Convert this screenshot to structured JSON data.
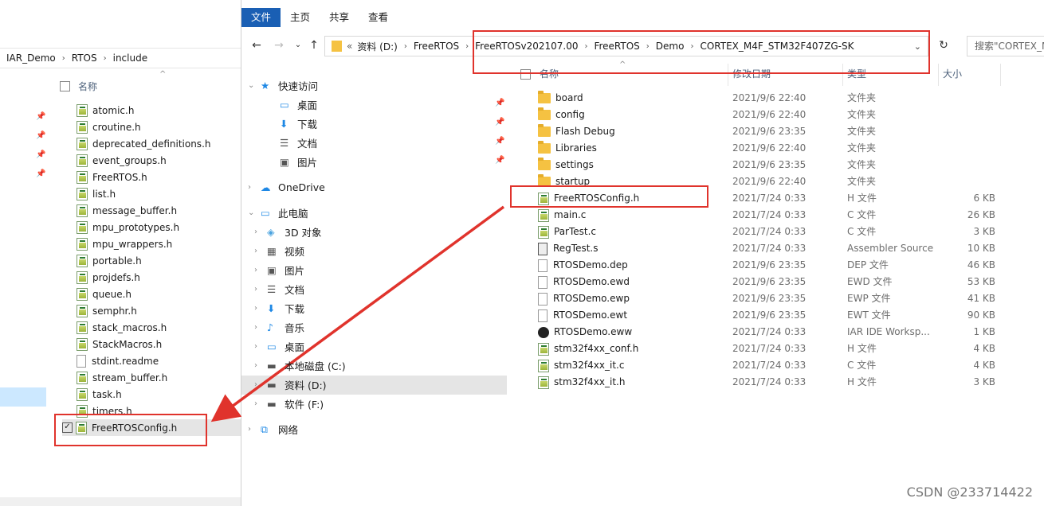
{
  "left_window": {
    "breadcrumb": [
      "IAR_Demo",
      "RTOS",
      "include"
    ],
    "column_name": "名称",
    "files": [
      "atomic.h",
      "croutine.h",
      "deprecated_definitions.h",
      "event_groups.h",
      "FreeRTOS.h",
      "list.h",
      "message_buffer.h",
      "mpu_prototypes.h",
      "mpu_wrappers.h",
      "portable.h",
      "projdefs.h",
      "queue.h",
      "semphr.h",
      "stack_macros.h",
      "StackMacros.h",
      "stdint.readme",
      "stream_buffer.h",
      "task.h",
      "timers.h"
    ],
    "selected_file": "FreeRTOSConfig.h"
  },
  "right_window": {
    "menu": [
      "文件",
      "主页",
      "共享",
      "查看"
    ],
    "address_prefix": "«",
    "address": [
      "资料 (D:)",
      "FreeRTOS",
      "FreeRTOSv202107.00",
      "FreeRTOS",
      "Demo",
      "CORTEX_M4F_STM32F407ZG-SK"
    ],
    "search_placeholder": "搜索\"CORTEX_M",
    "columns": {
      "name": "名称",
      "date": "修改日期",
      "type": "类型",
      "size": "大小"
    },
    "nav": [
      {
        "label": "快速访问",
        "icon": "star-icon"
      },
      {
        "label": "桌面",
        "icon": "desktop-icon",
        "pinned": true
      },
      {
        "label": "下载",
        "icon": "download-icon",
        "pinned": true
      },
      {
        "label": "文档",
        "icon": "document-icon",
        "pinned": true
      },
      {
        "label": "图片",
        "icon": "picture-icon",
        "pinned": true
      },
      {
        "label": "OneDrive",
        "icon": "cloud-icon"
      },
      {
        "label": "此电脑",
        "icon": "computer-icon"
      },
      {
        "label": "3D 对象",
        "icon": "cube-icon"
      },
      {
        "label": "视频",
        "icon": "video-icon"
      },
      {
        "label": "图片",
        "icon": "picture-icon"
      },
      {
        "label": "文档",
        "icon": "document-icon"
      },
      {
        "label": "下载",
        "icon": "download-icon"
      },
      {
        "label": "音乐",
        "icon": "music-icon"
      },
      {
        "label": "桌面",
        "icon": "desktop-icon"
      },
      {
        "label": "本地磁盘 (C:)",
        "icon": "drive-icon"
      },
      {
        "label": "资料 (D:)",
        "icon": "drive-icon"
      },
      {
        "label": "软件 (F:)",
        "icon": "drive-icon"
      },
      {
        "label": "网络",
        "icon": "network-icon"
      }
    ],
    "files": [
      {
        "name": "board",
        "date": "2021/9/6 22:40",
        "type": "文件夹",
        "size": "",
        "icon": "folder-icon"
      },
      {
        "name": "config",
        "date": "2021/9/6 22:40",
        "type": "文件夹",
        "size": "",
        "icon": "folder-icon"
      },
      {
        "name": "Flash Debug",
        "date": "2021/9/6 23:35",
        "type": "文件夹",
        "size": "",
        "icon": "folder-icon"
      },
      {
        "name": "Libraries",
        "date": "2021/9/6 22:40",
        "type": "文件夹",
        "size": "",
        "icon": "folder-icon"
      },
      {
        "name": "settings",
        "date": "2021/9/6 23:35",
        "type": "文件夹",
        "size": "",
        "icon": "folder-icon"
      },
      {
        "name": "startup",
        "date": "2021/9/6 22:40",
        "type": "文件夹",
        "size": "",
        "icon": "folder-icon"
      },
      {
        "name": "FreeRTOSConfig.h",
        "date": "2021/7/24 0:33",
        "type": "H 文件",
        "size": "6 KB",
        "icon": "header-file-icon"
      },
      {
        "name": "main.c",
        "date": "2021/7/24 0:33",
        "type": "C 文件",
        "size": "26 KB",
        "icon": "c-file-icon"
      },
      {
        "name": "ParTest.c",
        "date": "2021/7/24 0:33",
        "type": "C 文件",
        "size": "3 KB",
        "icon": "c-file-icon"
      },
      {
        "name": "RegTest.s",
        "date": "2021/7/24 0:33",
        "type": "Assembler Source",
        "size": "10 KB",
        "icon": "asm-file-icon"
      },
      {
        "name": "RTOSDemo.dep",
        "date": "2021/9/6 23:35",
        "type": "DEP 文件",
        "size": "46 KB",
        "icon": "file-icon"
      },
      {
        "name": "RTOSDemo.ewd",
        "date": "2021/9/6 23:35",
        "type": "EWD 文件",
        "size": "53 KB",
        "icon": "file-icon"
      },
      {
        "name": "RTOSDemo.ewp",
        "date": "2021/9/6 23:35",
        "type": "EWP 文件",
        "size": "41 KB",
        "icon": "file-icon"
      },
      {
        "name": "RTOSDemo.ewt",
        "date": "2021/9/6 23:35",
        "type": "EWT 文件",
        "size": "90 KB",
        "icon": "file-icon"
      },
      {
        "name": "RTOSDemo.eww",
        "date": "2021/7/24 0:33",
        "type": "IAR IDE Worksp...",
        "size": "1 KB",
        "icon": "iar-workspace-icon"
      },
      {
        "name": "stm32f4xx_conf.h",
        "date": "2021/7/24 0:33",
        "type": "H 文件",
        "size": "4 KB",
        "icon": "header-file-icon"
      },
      {
        "name": "stm32f4xx_it.c",
        "date": "2021/7/24 0:33",
        "type": "C 文件",
        "size": "4 KB",
        "icon": "c-file-icon"
      },
      {
        "name": "stm32f4xx_it.h",
        "date": "2021/7/24 0:33",
        "type": "H 文件",
        "size": "3 KB",
        "icon": "header-file-icon"
      }
    ]
  },
  "watermark": "CSDN @233714422",
  "colors": {
    "annotation_red": "#e0332c",
    "accent_blue": "#1a5fb4"
  }
}
